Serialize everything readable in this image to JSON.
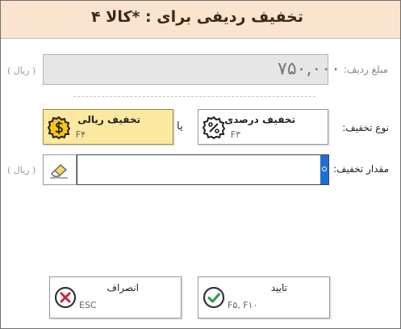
{
  "dialog": {
    "title": "تخفیف ردیفی برای : *کالا ۴"
  },
  "row_amount": {
    "label": "مبلغ ردیف:",
    "value": "۷۵۰,۰۰۰",
    "unit": "( ریال )"
  },
  "discount_type": {
    "label": "نوع تخفیف:",
    "separator": "یا",
    "percent_option": {
      "title": "تخفیف درصدی",
      "shortcut": "F۳",
      "icon": "percent-badge-icon"
    },
    "amount_option": {
      "title": "تخفیف ریالی",
      "shortcut": "F۴",
      "icon": "dollar-badge-icon",
      "selected": true
    }
  },
  "discount_amount": {
    "label": "مقدار تخفیف:",
    "value": "",
    "unit": "( ریال )",
    "clear_icon": "eraser-icon"
  },
  "actions": {
    "confirm": {
      "label": "تایید",
      "shortcut": "F۵, F۱۰",
      "icon": "check-circle-icon"
    },
    "cancel": {
      "label": "انصراف",
      "shortcut": "ESC",
      "icon": "x-circle-icon"
    }
  },
  "colors": {
    "header_bg": "#fae3cf",
    "selected_bg": "#fbe9a0",
    "caret": "#1f6fd0",
    "confirm_green": "#2a9a3f",
    "cancel_red": "#c8283a"
  }
}
